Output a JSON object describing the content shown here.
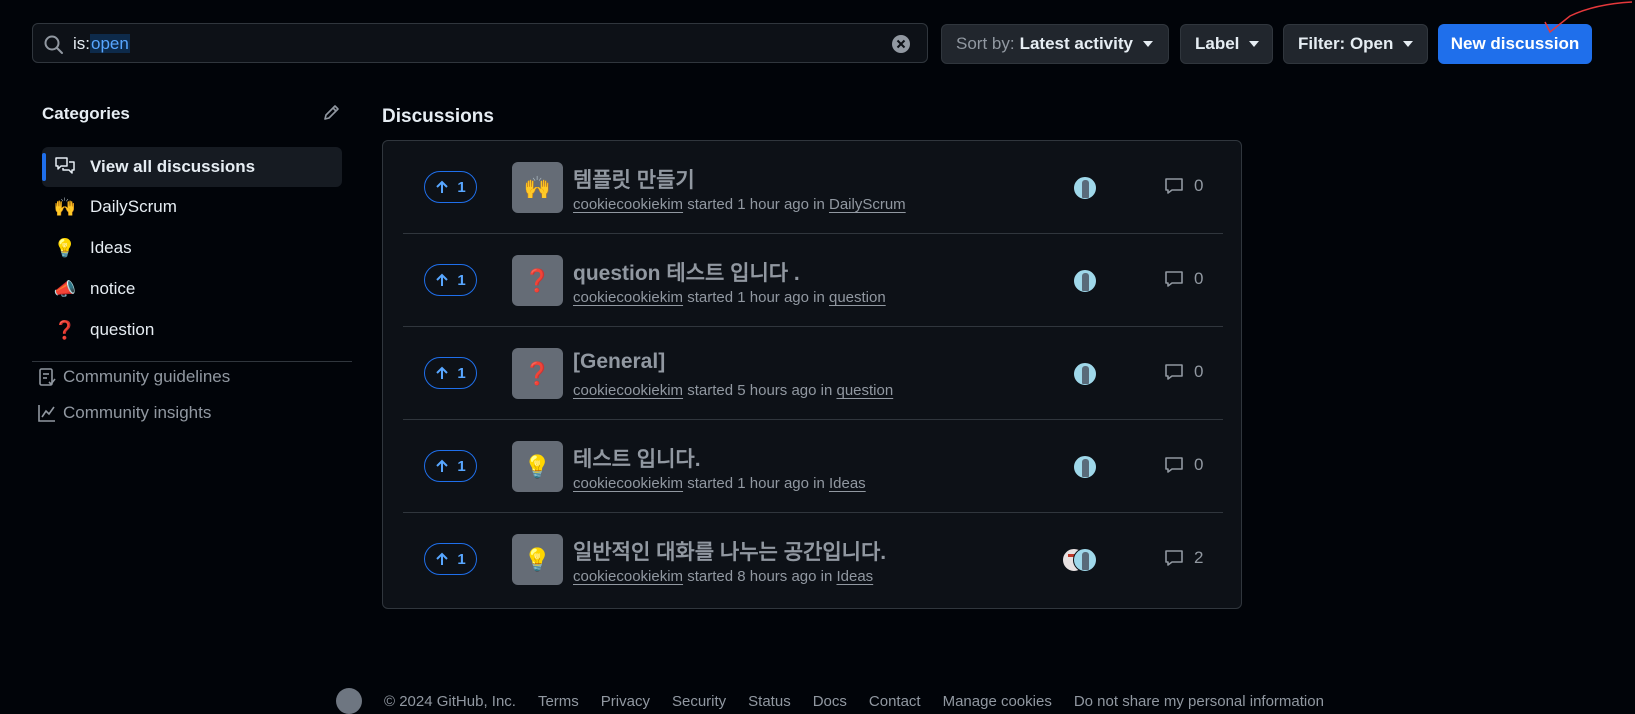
{
  "search": {
    "prefix": "is:",
    "highlight": "open"
  },
  "toolbar": {
    "sort_prefix": "Sort by:",
    "sort_value": "Latest activity",
    "label": "Label",
    "filter": "Filter: Open",
    "new_discussion": "New discussion"
  },
  "sidebar": {
    "title": "Categories",
    "items": [
      {
        "emoji": "🙌",
        "label": "DailyScrum"
      },
      {
        "emoji": "💡",
        "label": "Ideas"
      },
      {
        "emoji": "📣",
        "label": "notice"
      },
      {
        "emoji": "❓",
        "label": "question"
      }
    ],
    "view_all": "View all discussions",
    "links": [
      "Community guidelines",
      "Community insights"
    ]
  },
  "discussions": {
    "title": "Discussions",
    "rows": [
      {
        "votes": "1",
        "emoji": "🙌",
        "title": "템플릿 만들기",
        "author": "cookiecookiekim",
        "started": "started 1 hour ago in",
        "category": "DailyScrum",
        "comments": "0"
      },
      {
        "votes": "1",
        "emoji": "❓",
        "title": "question 테스트 입니다 .",
        "author": "cookiecookiekim",
        "started": "started 1 hour ago in",
        "category": "question",
        "comments": "0"
      },
      {
        "votes": "1",
        "emoji": "❓",
        "title": "[General]",
        "author": "cookiecookiekim",
        "started": "started 5 hours ago in",
        "category": "question",
        "comments": "0"
      },
      {
        "votes": "1",
        "emoji": "💡",
        "title": "테스트 입니다.",
        "author": "cookiecookiekim",
        "started": "started 1 hour ago in",
        "category": "Ideas",
        "comments": "0"
      },
      {
        "votes": "1",
        "emoji": "💡",
        "title": "일반적인 대화를 나누는 공간입니다.",
        "author": "cookiecookiekim",
        "started": "started 8 hours ago in",
        "category": "Ideas",
        "comments": "2"
      }
    ]
  },
  "footer": {
    "copyright": "© 2024 GitHub, Inc.",
    "links": [
      "Terms",
      "Privacy",
      "Security",
      "Status",
      "Docs",
      "Contact",
      "Manage cookies",
      "Do not share my personal information"
    ]
  },
  "colors": {
    "accent": "#1f6feb",
    "link": "#58a6ff",
    "background": "#010409"
  }
}
